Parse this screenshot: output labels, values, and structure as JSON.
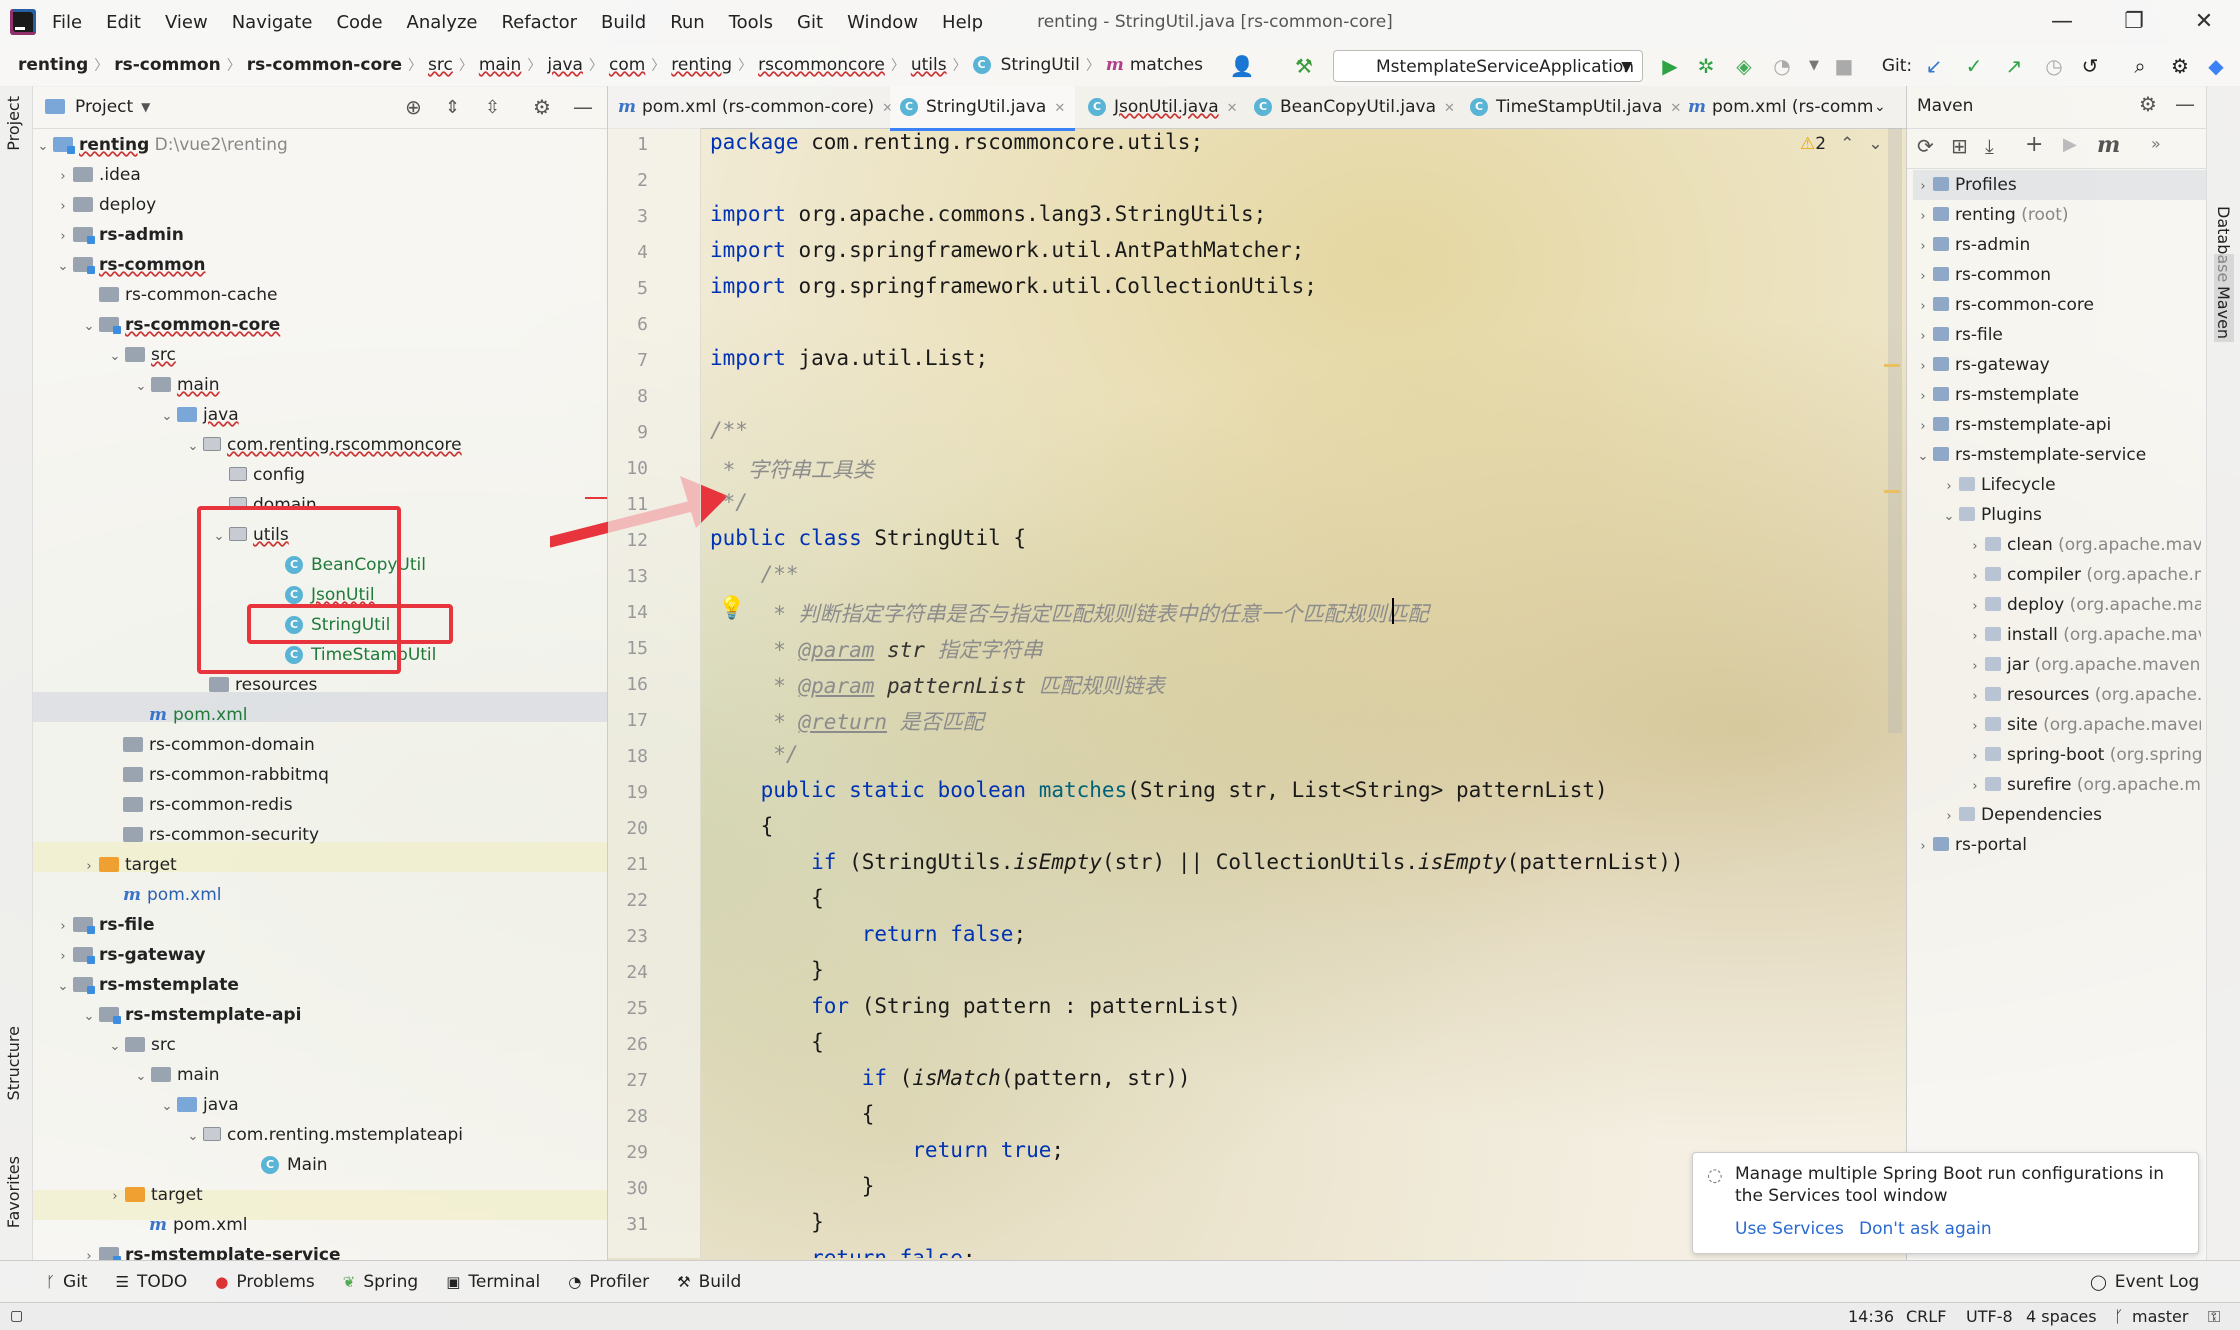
{
  "menu": {
    "items": [
      "File",
      "Edit",
      "View",
      "Navigate",
      "Code",
      "Analyze",
      "Refactor",
      "Build",
      "Run",
      "Tools",
      "Git",
      "Window",
      "Help"
    ],
    "window_title": "renting - StringUtil.java [rs-common-core]"
  },
  "breadcrumb": [
    "renting",
    "rs-common",
    "rs-common-core",
    "src",
    "main",
    "java",
    "com",
    "renting",
    "rscommoncore",
    "utils",
    "StringUtil",
    "matches"
  ],
  "toolbar": {
    "run_config": "MstemplateServiceApplication",
    "git_label": "Git:"
  },
  "project": {
    "header": "Project",
    "root_label": "renting",
    "root_path": "D:\\vue2\\renting",
    "rows": {
      "idea": ".idea",
      "deploy": "deploy",
      "rs_admin": "rs-admin",
      "rs_common": "rs-common",
      "rs_common_cache": "rs-common-cache",
      "rs_common_core": "rs-common-core",
      "src": "src",
      "main": "main",
      "java": "java",
      "pkg_core": "com.renting.rscommoncore",
      "config": "config",
      "domain": "domain",
      "utils": "utils",
      "bean_copy": "BeanCopyUtil",
      "json_util": "JsonUtil",
      "string_util": "StringUtil",
      "timestamp_util": "TimeStampUtil",
      "resources": "resources",
      "pom_core": "pom.xml",
      "rs_common_domain": "rs-common-domain",
      "rs_common_rabbitmq": "rs-common-rabbitmq",
      "rs_common_redis": "rs-common-redis",
      "rs_common_security": "rs-common-security",
      "target": "target",
      "pom_common": "pom.xml",
      "rs_file": "rs-file",
      "rs_gateway": "rs-gateway",
      "rs_mstemplate": "rs-mstemplate",
      "rs_mstemplate_api": "rs-mstemplate-api",
      "src2": "src",
      "main2": "main",
      "java2": "java",
      "pkg_api": "com.renting.mstemplateapi",
      "main_class": "Main",
      "target2": "target",
      "pom_api": "pom.xml",
      "rs_mstemplate_service": "rs-mstemplate-service"
    }
  },
  "editor": {
    "tabs": [
      "pom.xml (rs-common-core)",
      "StringUtil.java",
      "JsonUtil.java",
      "BeanCopyUtil.java",
      "TimeStampUtil.java",
      "pom.xml (rs-comm"
    ],
    "warning_count": "2",
    "line_numbers": [
      "1",
      "2",
      "3",
      "4",
      "5",
      "6",
      "7",
      "8",
      "9",
      "10",
      "11",
      "12",
      "13",
      "14",
      "15",
      "16",
      "17",
      "18",
      "19",
      "20",
      "21",
      "22",
      "23",
      "24",
      "25",
      "26",
      "27",
      "28",
      "29",
      "30",
      "31"
    ],
    "code": {
      "l1_kw": "package",
      "l1": " com.renting.rscommoncore.utils;",
      "imp": "import",
      "l3": " org.apache.commons.lang3.StringUtils;",
      "l4": " org.springframework.util.AntPathMatcher;",
      "l5": " org.springframework.util.CollectionUtils;",
      "l7": " java.util.List;",
      "l9": "/**",
      "l10": " * 字符串工具类",
      "l11": " */",
      "l12_a": "public class",
      "l12_b": " StringUtil {",
      "l13": "    /**",
      "l14": "     * 判断指定字符串是否与指定匹配规则链表中的任意一个匹配规则匹配",
      "l15_pre": "     * ",
      "param_tag": "@param",
      "l15_name": " str",
      "l15_desc": " 指定字符串",
      "l16_name": " patternList",
      "l16_desc": " 匹配规则链表",
      "return_tag": "@return",
      "l17_desc": " 是否匹配",
      "l18": "     */",
      "l19_kw": "    public static boolean",
      "l19_fn": " matches",
      "l19_rest": "(String str, List<String> patternList)",
      "l20": "    {",
      "l21_kw": "        if",
      "l21_a": " (StringUtils.",
      "l21_m1": "isEmpty",
      "l21_b": "(str) || CollectionUtils.",
      "l21_c": "(patternList))",
      "l22": "        {",
      "l23_kw": "            return false",
      "l23": ";",
      "l24": "        }",
      "l25_kw": "        for",
      "l25": " (String pattern : patternList)",
      "l26": "        {",
      "l27_kw": "            if",
      "l27_a": " (",
      "l27_m": "isMatch",
      "l27_b": "(pattern, str))",
      "l28": "            {",
      "l29_kw": "                return true",
      "l29": ";",
      "l30": "            }",
      "l31": "        }",
      "l32_kw": "        return false",
      "l32": ";"
    }
  },
  "maven": {
    "header": "Maven",
    "profiles": "Profiles",
    "projects": [
      {
        "name": "renting",
        "suffix": "(root)"
      },
      {
        "name": "rs-admin",
        "suffix": ""
      },
      {
        "name": "rs-common",
        "suffix": ""
      },
      {
        "name": "rs-common-core",
        "suffix": ""
      },
      {
        "name": "rs-file",
        "suffix": ""
      },
      {
        "name": "rs-gateway",
        "suffix": ""
      },
      {
        "name": "rs-mstemplate",
        "suffix": ""
      },
      {
        "name": "rs-mstemplate-api",
        "suffix": ""
      },
      {
        "name": "rs-mstemplate-service",
        "suffix": ""
      }
    ],
    "lifecycle": "Lifecycle",
    "plugins": "Plugins",
    "plugin_list": [
      {
        "name": "clean",
        "suffix": "(org.apache.maver"
      },
      {
        "name": "compiler",
        "suffix": "(org.apache.ma"
      },
      {
        "name": "deploy",
        "suffix": "(org.apache.mav"
      },
      {
        "name": "install",
        "suffix": "(org.apache.mave"
      },
      {
        "name": "jar",
        "suffix": "(org.apache.maven.p"
      },
      {
        "name": "resources",
        "suffix": "(org.apache.m"
      },
      {
        "name": "site",
        "suffix": "(org.apache.maven.p"
      },
      {
        "name": "spring-boot",
        "suffix": "(org.springf"
      },
      {
        "name": "surefire",
        "suffix": "(org.apache.mav"
      }
    ],
    "dependencies": "Dependencies",
    "rs_portal": "rs-portal"
  },
  "side_tabs": {
    "project": "Project",
    "structure": "Structure",
    "favorites": "Favorites",
    "database": "Database",
    "maven": "Maven"
  },
  "notification": {
    "text": "Manage multiple Spring Boot run configurations in the Services tool window",
    "link1": "Use Services",
    "link2": "Don't ask again"
  },
  "bottom_tools": [
    "Git",
    "TODO",
    "Problems",
    "Spring",
    "Terminal",
    "Profiler",
    "Build"
  ],
  "event_log": "Event Log",
  "status": {
    "position": "14:36",
    "line_sep": "CRLF",
    "encoding": "UTF-8",
    "indent": "4 spaces",
    "branch": "master"
  },
  "colors": {
    "accent": "#3b82f6",
    "highlight_red": "#e8343c",
    "keyword": "#0033b3"
  }
}
